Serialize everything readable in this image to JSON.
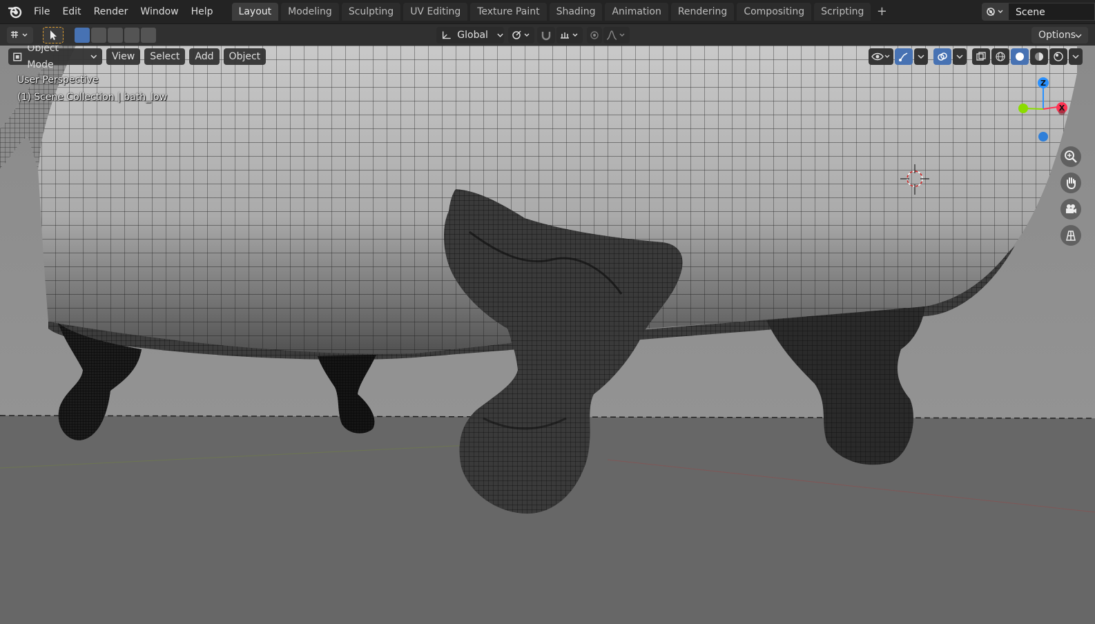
{
  "app": {
    "menu": [
      "File",
      "Edit",
      "Render",
      "Window",
      "Help"
    ],
    "workspaces": [
      "Layout",
      "Modeling",
      "Sculpting",
      "UV Editing",
      "Texture Paint",
      "Shading",
      "Animation",
      "Rendering",
      "Compositing",
      "Scripting"
    ],
    "active_workspace": "Layout",
    "add_workspace": "+",
    "scene_name": "Scene"
  },
  "toolheader": {
    "transform_orientation": "Global",
    "options_label": "Options"
  },
  "viewport": {
    "mode": "Object Mode",
    "menus": [
      "View",
      "Select",
      "Add",
      "Object"
    ],
    "perspective_label": "User Perspective",
    "collection_label": "(1) Scene Collection | bath_low",
    "gizmo": {
      "z": "Z",
      "x": "X"
    }
  },
  "colors": {
    "accent": "#4772b3",
    "axis_x": "#ff3352",
    "axis_y": "#8bdc00",
    "axis_z": "#2890ff"
  }
}
